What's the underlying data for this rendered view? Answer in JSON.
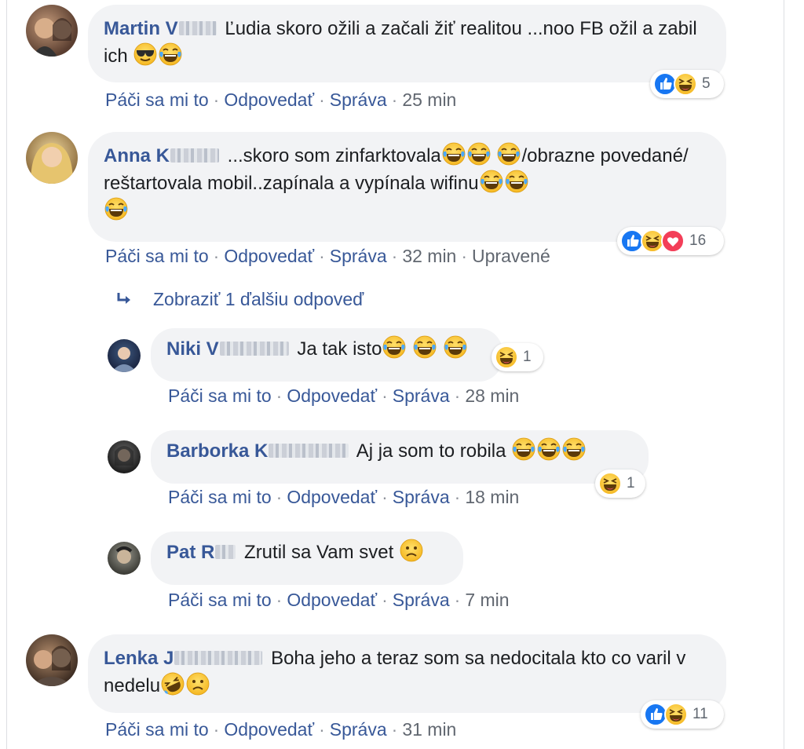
{
  "actions": {
    "like": "Páči sa mi to",
    "reply": "Odpovedať",
    "message": "Správa",
    "edited": "Upravené"
  },
  "more_replies": {
    "label": "Zobraziť 1 ďalšiu odpoveď",
    "icon": "reply-arrow-icon"
  },
  "colors": {
    "link": "#385898",
    "bubble": "#f2f3f5",
    "like_blue": "#1877f2",
    "haha_yellow": "#f7b125",
    "love_red": "#f33e58"
  },
  "comments": [
    {
      "author": "Martin V",
      "text": "Ľudia skoro ožili a začali žiť realitou ...noo FB ožil a zabil ich",
      "emojis": [
        "cool-face-icon",
        "tears-of-joy-icon"
      ],
      "time": "25 min",
      "reactions": [
        "like",
        "haha"
      ],
      "reaction_count": "5"
    },
    {
      "author": "Anna K",
      "text": "...skoro som zinfarktovala",
      "text2": "/obrazne povedané/ reštartovala mobil..zapínala a vypínala wifinu",
      "emojis": [
        "tears-of-joy-icon",
        "tears-of-joy-icon",
        "tears-of-joy-icon",
        "tears-of-joy-icon",
        "tears-of-joy-icon",
        "tears-of-joy-icon"
      ],
      "time": "32 min",
      "reactions": [
        "like",
        "haha",
        "love"
      ],
      "reaction_count": "16"
    },
    {
      "author": "Niki V",
      "text": "Ja tak isto",
      "emojis": [
        "tears-of-joy-icon",
        "tears-of-joy-icon",
        "tears-of-joy-icon"
      ],
      "time": "28 min",
      "reactions": [
        "haha"
      ],
      "reaction_count": "1"
    },
    {
      "author": "Barborka K",
      "text": "Aj ja som to robila",
      "emojis": [
        "tears-of-joy-icon",
        "tears-of-joy-icon",
        "tears-of-joy-icon"
      ],
      "time": "18 min",
      "reactions": [
        "haha"
      ],
      "reaction_count": "1"
    },
    {
      "author": "Pat R",
      "text": "Zrutil sa Vam svet",
      "emojis": [
        "sad-face-icon"
      ],
      "time": "7 min"
    },
    {
      "author": "Lenka J",
      "text": "Boha jeho a teraz som sa nedocitala kto co varil v nedelu",
      "emojis": [
        "rolling-laughing-icon",
        "sad-face-icon"
      ],
      "time": "31 min",
      "reactions": [
        "like",
        "haha"
      ],
      "reaction_count": "11"
    }
  ]
}
